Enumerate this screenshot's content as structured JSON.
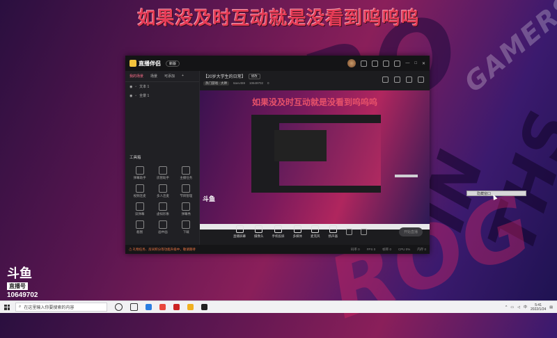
{
  "banner_text": "如果没及时互动就是没看到呜呜呜",
  "app": {
    "name": "直播伴侣",
    "version_badge": "新版",
    "sidebar_tabs": [
      "我的场景",
      "场景",
      "可添加"
    ],
    "scenes": [
      "文本 1",
      "全景 1"
    ],
    "tools_heading": "工具箱",
    "tools": [
      "弹幕助手",
      "房管助手",
      "主播任务",
      "视频连麦",
      "多人连麦",
      "节目管理",
      "读弹幕",
      "虚拟形象",
      "弹幕秀",
      "截图",
      "画中画",
      "下载"
    ],
    "room_title": "【20岁大学生的日常】",
    "edit_label": "修改",
    "category": "热门游戏 · 大神",
    "viewers": "6avv459",
    "room_id": "10649702",
    "likes": "0",
    "preview_title": "如果没及时互动就是没看到呜呜呜",
    "preview_logo": "斗鱼",
    "controls": [
      "直播屏幕",
      "摄像头",
      "手机投屏",
      "多媒体",
      "麦克风",
      "扬声器"
    ],
    "start_button": "开始直播",
    "status_warning": "⚠ 礼物任务、房间积分等功能升级中，敬请期待",
    "status_items": [
      "码率 0",
      "FPS 0",
      "帧率 0",
      "CPU 0%",
      "内存 0"
    ]
  },
  "tooltip_text": "隐藏窗口",
  "watermark": {
    "line1": "斗鱼",
    "line2": "直播号",
    "line3": "10649702"
  },
  "taskbar": {
    "search_placeholder": "在这里输入你要搜索的内容",
    "time": "5:41",
    "date": "2022/1/24"
  }
}
